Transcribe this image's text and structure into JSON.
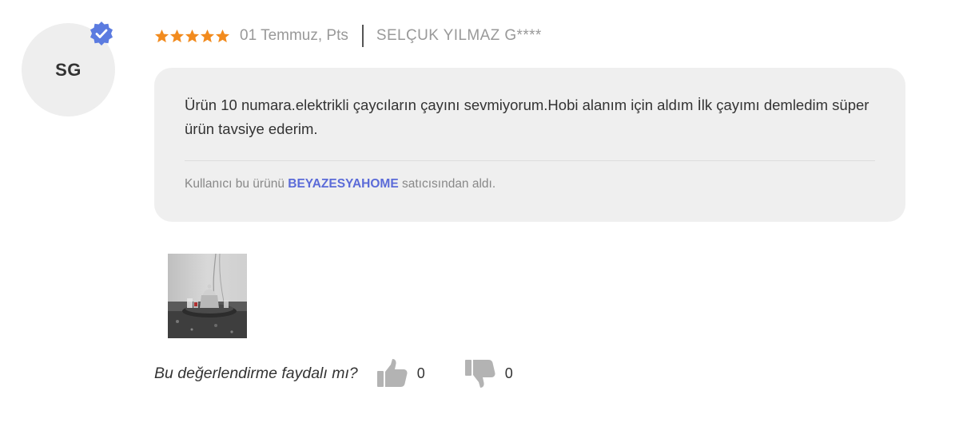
{
  "reviewer": {
    "initials": "SG",
    "name": "SELÇUK YILMAZ G****",
    "verified": true
  },
  "rating": {
    "stars": 5,
    "max": 5
  },
  "date": "01 Temmuz, Pts",
  "comment": "Ürün 10 numara.elektrikli çaycıların çayını sevmiyorum.Hobi alanım için aldım İlk çayımı demledim süper ürün tavsiye ederim.",
  "seller_note": {
    "prefix": "Kullanıcı bu ürünü ",
    "seller": "BEYAZESYAHOME",
    "suffix": " satıcısından aldı."
  },
  "helpful": {
    "question": "Bu değerlendirme faydalı mı?",
    "likes": "0",
    "dislikes": "0"
  },
  "colors": {
    "star": "#f28b1e",
    "badge": "#5b7be0",
    "seller_link": "#5b6bd8"
  },
  "icons": [
    "verified-badge-icon",
    "star-icon",
    "thumbs-up-icon",
    "thumbs-down-icon"
  ]
}
